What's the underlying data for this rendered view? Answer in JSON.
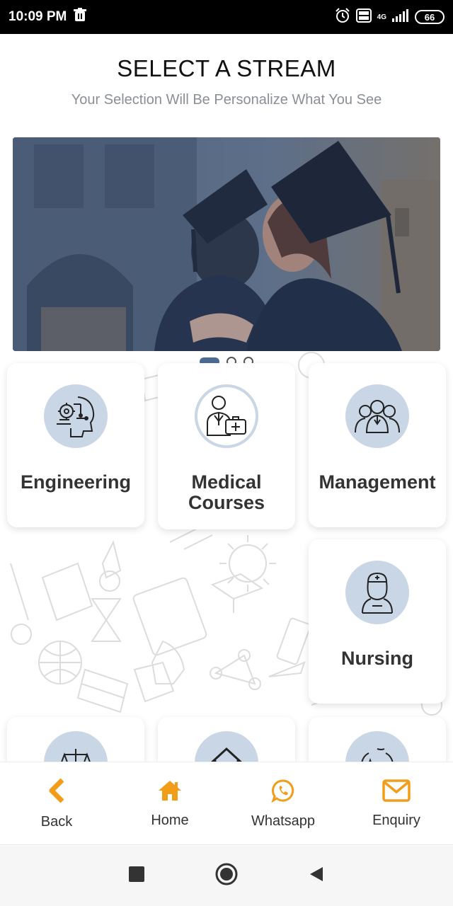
{
  "status_bar": {
    "time": "10:09 PM",
    "network": "4G",
    "battery": "66"
  },
  "header": {
    "title": "SELECT A STREAM",
    "subtitle": "Your Selection Will Be Personalize What You See"
  },
  "banner": {
    "image": "graduates-hugging-photo",
    "slides": 3,
    "active_slide": 1
  },
  "streams": [
    {
      "label": "Engineering",
      "icon": "engineering-icon"
    },
    {
      "label": "Medical Courses",
      "icon": "medical-icon"
    },
    {
      "label": "Management",
      "icon": "management-icon"
    },
    {
      "label": "Nursing",
      "icon": "nursing-icon"
    }
  ],
  "partial_streams": [
    {
      "icon": "law-scale-icon"
    },
    {
      "icon": "house-icon"
    },
    {
      "icon": "sparkle-icon"
    }
  ],
  "bottom_nav": [
    {
      "label": "Back",
      "icon": "chevron-left-icon"
    },
    {
      "label": "Home",
      "icon": "home-icon"
    },
    {
      "label": "Whatsapp",
      "icon": "whatsapp-icon"
    },
    {
      "label": "Enquiry",
      "icon": "mail-icon"
    }
  ],
  "colors": {
    "accent": "#f29d1a",
    "icon_circle": "#c9d6e6",
    "dot_active": "#4d6c93"
  }
}
